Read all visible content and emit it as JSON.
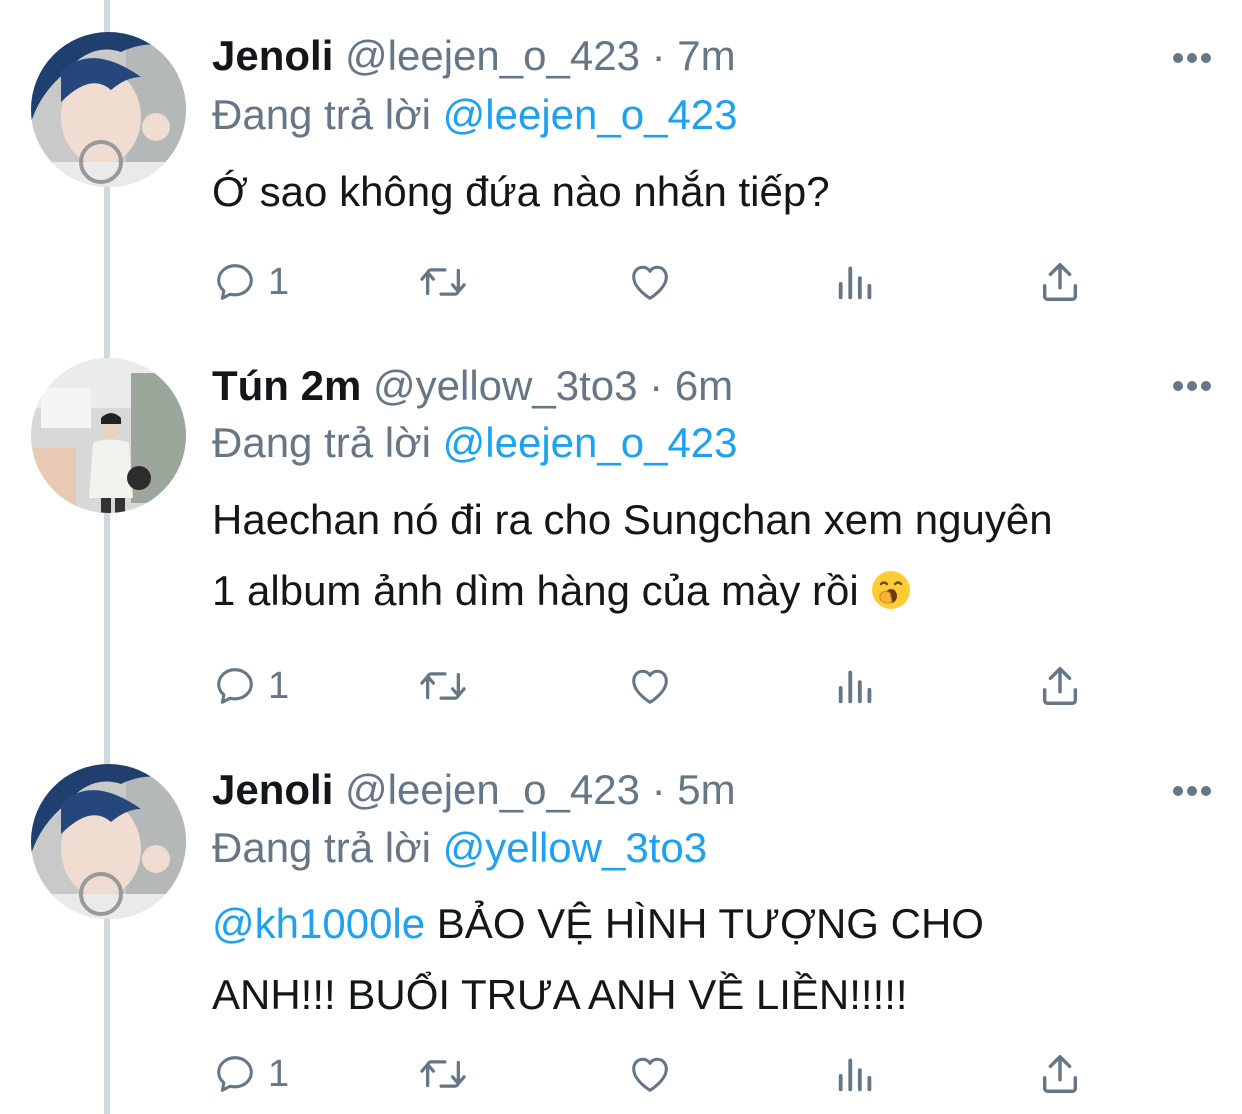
{
  "tweets": [
    {
      "display_name": "Jenoli",
      "handle": "@leejen_o_423",
      "separator": "·",
      "time": "7m",
      "replying_label": "Đang trả lời",
      "replying_to": "@leejen_o_423",
      "text_mention": "",
      "text_line1": "Ớ sao không đứa nào nhắn tiếp?",
      "text_line2": "",
      "emoji": "",
      "reply_count": "1"
    },
    {
      "display_name": "Tún 2m",
      "handle": "@yellow_3to3",
      "separator": "·",
      "time": "6m",
      "replying_label": "Đang trả lời",
      "replying_to": "@leejen_o_423",
      "text_mention": "",
      "text_line1": "Haechan nó đi ra cho Sungchan xem nguyên",
      "text_line2": "1 album ảnh dìm hàng của mày rồi",
      "emoji": "yawning-face-emoji",
      "reply_count": "1"
    },
    {
      "display_name": "Jenoli",
      "handle": "@leejen_o_423",
      "separator": "·",
      "time": "5m",
      "replying_label": "Đang trả lời",
      "replying_to": "@yellow_3to3",
      "text_mention": "@kh1000le",
      "text_line1": " BẢO VỆ HÌNH TƯỢNG CHO",
      "text_line2": "ANH!!! BUỔI TRƯA ANH VỀ LIỀN!!!!!",
      "emoji": "",
      "reply_count": "1"
    }
  ],
  "icons": {
    "reply": "speech-bubble-icon",
    "retweet": "retweet-icon",
    "like": "heart-icon",
    "analytics": "bar-chart-icon",
    "share": "share-upload-icon",
    "more": "ellipsis-icon"
  },
  "colors": {
    "text": "#14171a",
    "secondary": "#657786",
    "link": "#1da1f2",
    "thread_line": "#cfd9de"
  }
}
